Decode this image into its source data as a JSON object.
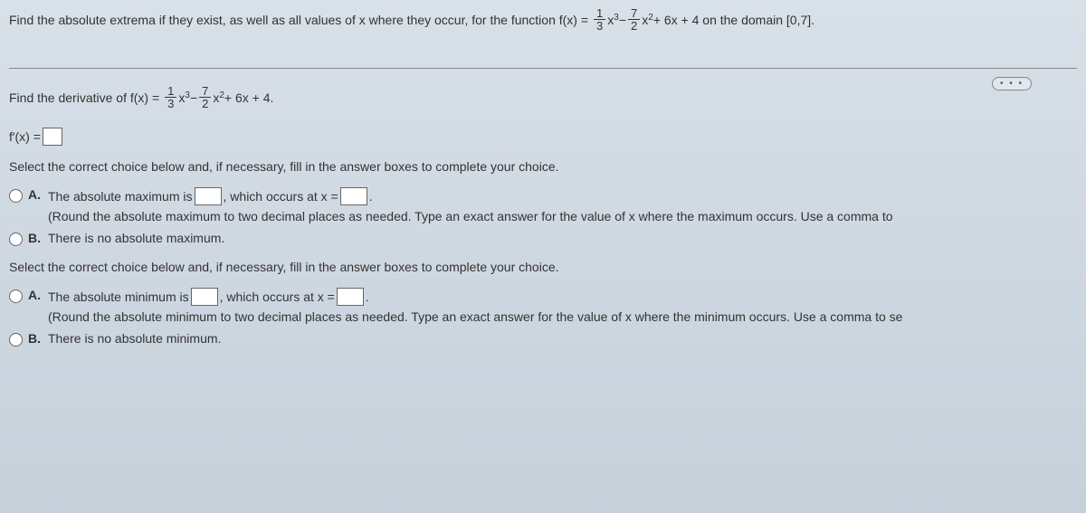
{
  "header": {
    "prefix": "Find the absolute extrema if they exist, as well as all values of x where they occur, for the function f(x) =",
    "frac1_num": "1",
    "frac1_den": "3",
    "term1": "x",
    "exp1": "3",
    "minus1": " − ",
    "frac2_num": "7",
    "frac2_den": "2",
    "term2": "x",
    "exp2": "2",
    "suffix": " + 6x + 4 on the domain [0,7]."
  },
  "dots": "• • •",
  "derivative": {
    "prefix": "Find the derivative of f(x) =",
    "frac1_num": "1",
    "frac1_den": "3",
    "term1": "x",
    "exp1": "3",
    "minus1": " − ",
    "frac2_num": "7",
    "frac2_den": "2",
    "term2": "x",
    "exp2": "2",
    "suffix": " + 6x + 4."
  },
  "fprime": "f′(x) =",
  "select1": "Select the correct choice below and, if necessary, fill in the answer boxes to complete your choice.",
  "max": {
    "labelA": "A.",
    "text1": "The absolute maximum is ",
    "text2": ", which occurs at x = ",
    "text3": ".",
    "hint": "(Round the absolute maximum to two decimal places as needed. Type an exact answer for the value of x where the maximum occurs. Use a comma to",
    "labelB": "B.",
    "textB": "There is no absolute maximum."
  },
  "select2": "Select the correct choice below and, if necessary, fill in the answer boxes to complete your choice.",
  "min": {
    "labelA": "A.",
    "text1": "The absolute minimum is ",
    "text2": ", which occurs at x = ",
    "text3": ".",
    "hint": "(Round the absolute minimum to two decimal places as needed. Type an exact answer for the value of x where the minimum occurs. Use a comma to se",
    "labelB": "B.",
    "textB": "There is no absolute minimum."
  }
}
